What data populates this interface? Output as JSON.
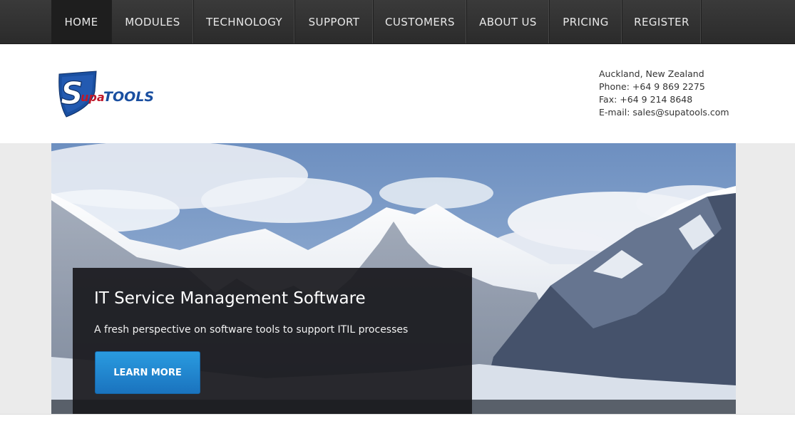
{
  "nav": {
    "items": [
      {
        "label": "HOME",
        "active": true
      },
      {
        "label": "MODULES"
      },
      {
        "label": "TECHNOLOGY"
      },
      {
        "label": "SUPPORT"
      },
      {
        "label": "CUSTOMERS"
      },
      {
        "label": "ABOUT US"
      },
      {
        "label": "PRICING"
      },
      {
        "label": "REGISTER"
      }
    ]
  },
  "logo": {
    "brand_supa": "upa",
    "brand_s": "S",
    "brand_tools": "TOOLS"
  },
  "contact": {
    "location": "Auckland, New Zealand",
    "phone": "Phone: +64 9 869 2275",
    "fax": "Fax: +64 9 214 8648",
    "email": "E-mail: sales@supatools.com"
  },
  "hero": {
    "title": "IT Service Management Software",
    "subtitle": "A fresh perspective on software tools to support ITIL processes",
    "button_label": "LEARN MORE"
  },
  "colors": {
    "brand_blue": "#1a4fa0",
    "button_blue": "#1f86d0",
    "nav_bg": "#333333"
  }
}
